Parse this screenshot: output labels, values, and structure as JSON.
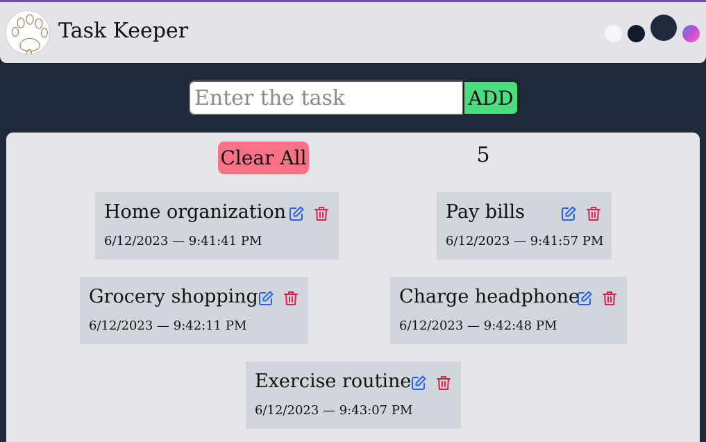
{
  "header": {
    "title": "Task Keeper",
    "logo": "paw-logo",
    "theme_colors": [
      "#f6f6f8",
      "#111a2e",
      "#1e293b",
      "gradient"
    ]
  },
  "form": {
    "placeholder": "Enter the task",
    "value": "",
    "add_label": "ADD"
  },
  "toolbar": {
    "clear_label": "Clear All",
    "count": "5"
  },
  "icons": {
    "edit": "edit-icon",
    "delete": "trash-icon"
  },
  "colors": {
    "add": "#4ade80",
    "clear": "#fb7185",
    "edit": "#2563eb",
    "delete": "#e11d48",
    "background": "#1e293b"
  },
  "tasks": [
    {
      "title": "Home organization",
      "time": "6/12/2023 — 9:41:41 PM"
    },
    {
      "title": "Pay bills",
      "time": "6/12/2023 — 9:41:57 PM"
    },
    {
      "title": "Grocery shopping",
      "time": "6/12/2023 — 9:42:11 PM"
    },
    {
      "title": "Charge headphone",
      "time": "6/12/2023 — 9:42:48 PM"
    },
    {
      "title": "Exercise routine",
      "time": "6/12/2023 — 9:43:07 PM"
    }
  ]
}
